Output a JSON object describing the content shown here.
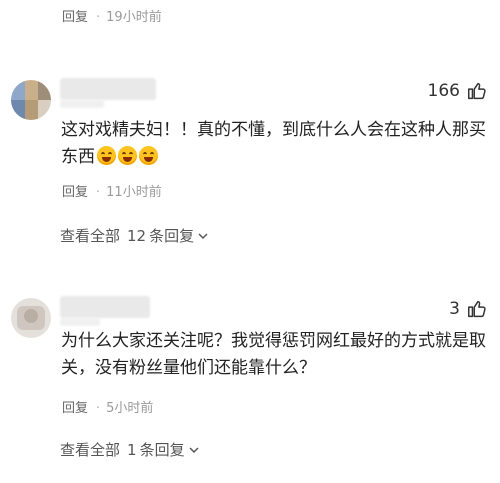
{
  "prev_reply": {
    "reply_label": "回复",
    "time": "19小时前"
  },
  "comments": [
    {
      "likes": "166",
      "text_line1": "这对戏精夫妇！！真的不懂，到底什么人会在这种人那买",
      "text_line2": "东西",
      "emoji_icon": "laughing-tears-emoji",
      "reply_label": "回复",
      "time": "11小时前",
      "view_all_prefix": "查看全部",
      "reply_count": "12",
      "view_all_suffix": "条回复"
    },
    {
      "likes": "3",
      "text_line1": "为什么大家还关注呢？我觉得惩罚网红最好的方式就是取",
      "text_line2": "关，没有粉丝量他们还能靠什么？",
      "reply_label": "回复",
      "time": "5小时前",
      "view_all_prefix": "查看全部",
      "reply_count": "1",
      "view_all_suffix": "条回复"
    }
  ],
  "colors": {
    "text": "#222222",
    "meta": "#666666",
    "time": "#9a9a9a",
    "emoji": "#ffc31f"
  }
}
